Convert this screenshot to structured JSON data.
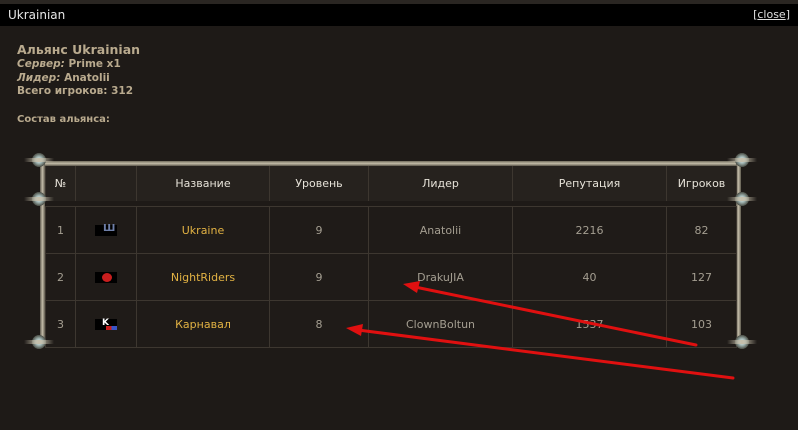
{
  "window": {
    "title": "Ukrainian",
    "close_left": "[",
    "close_label": "close",
    "close_right": "]"
  },
  "alliance": {
    "name": "Альянс Ukrainian",
    "server_label": "Сервер:",
    "server_value": "Prime x1",
    "leader_label": "Лидер:",
    "leader_value": "Anatolii",
    "players_label": "Всего игроков:",
    "players_value": "312",
    "members_heading": "Состав альянса:"
  },
  "table": {
    "headers": [
      "№",
      "",
      "Название",
      "Уровень",
      "Лидер",
      "Репутация",
      "Игроков"
    ],
    "rows": [
      {
        "num": "1",
        "emblem": "trident-emblem-icon",
        "name": "Ukraine",
        "level": "9",
        "leader": "Anatolii",
        "reputation": "2216",
        "players": "82"
      },
      {
        "num": "2",
        "emblem": "red-circle-emblem-icon",
        "name": "NightRiders",
        "level": "9",
        "leader": "DrakuJIA",
        "reputation": "40",
        "players": "127"
      },
      {
        "num": "3",
        "emblem": "k-letter-emblem-icon",
        "name": "Карнавал",
        "level": "8",
        "leader": "ClownBoltun",
        "reputation": "1537",
        "players": "103"
      }
    ]
  },
  "annotation_colors": {
    "arrow": "#e01010"
  },
  "emblem_glyphs": {
    "ukraine": "Ш",
    "karnaval": "K"
  }
}
